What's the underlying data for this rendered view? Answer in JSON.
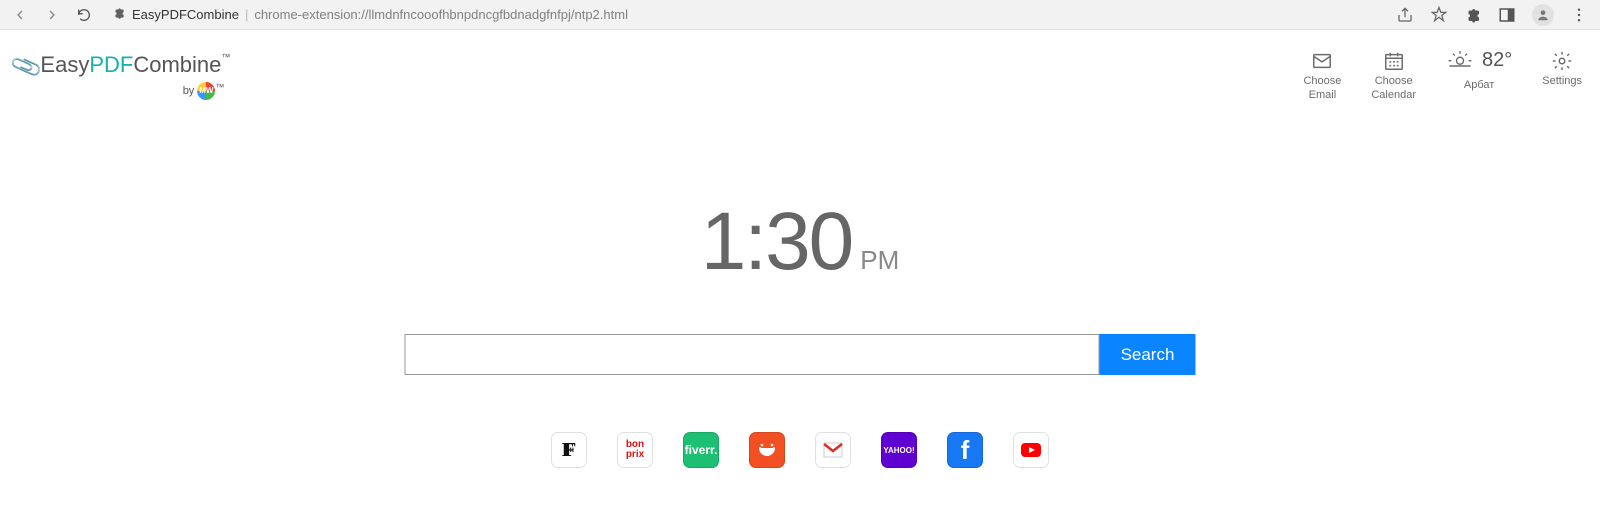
{
  "chrome": {
    "title": "EasyPDFCombine",
    "url": "chrome-extension://llmdnfncooofhbnpdncgfbdnadgfnfpj/ntp2.html"
  },
  "logo": {
    "part1": "Easy",
    "part2": "PDF",
    "part3": "Combine",
    "tm": "™",
    "by": "by",
    "mw": "MW"
  },
  "toolbar": {
    "email": {
      "l1": "Choose",
      "l2": "Email"
    },
    "calendar": {
      "l1": "Choose",
      "l2": "Calendar"
    },
    "weather": {
      "temp": "82°",
      "location": "Арбат"
    },
    "settings": {
      "label": "Settings"
    }
  },
  "clock": {
    "time": "1:30",
    "ampm": "PM"
  },
  "search": {
    "value": "",
    "button": "Search"
  },
  "quicklinks": [
    {
      "name": "farfetch",
      "label": "F"
    },
    {
      "name": "bonprix",
      "label": "bon\nprix"
    },
    {
      "name": "fiverr",
      "label": "fiverr."
    },
    {
      "name": "aliexpress",
      "label": "AliExpress"
    },
    {
      "name": "gmail",
      "label": ""
    },
    {
      "name": "yahoo",
      "label": "YAHOO!"
    },
    {
      "name": "facebook",
      "label": "f"
    },
    {
      "name": "youtube",
      "label": ""
    }
  ]
}
